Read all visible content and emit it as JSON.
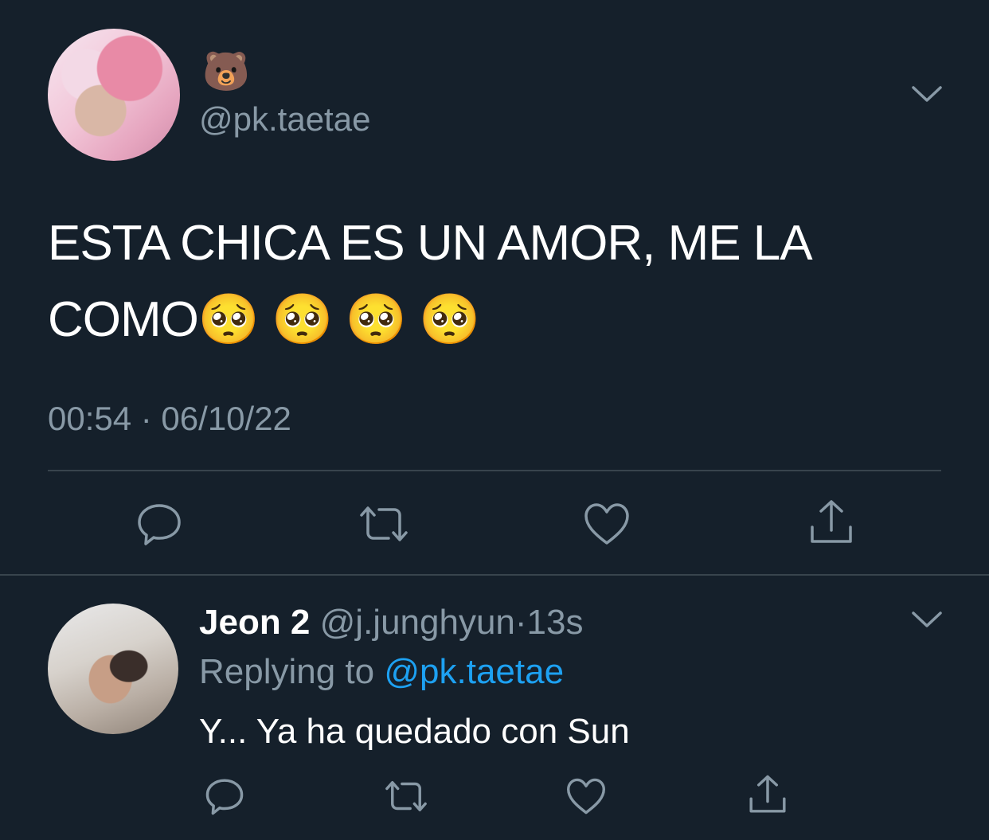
{
  "main_tweet": {
    "display_name": "🐻",
    "handle": "@pk.taetae",
    "text": "ESTA CHICA ES UN AMOR, ME LA COMO🥺 🥺 🥺 🥺",
    "timestamp": "00:54 · 06/10/22",
    "avatar_icon": "profile-photo",
    "menu_icon": "chevron-down-icon",
    "actions": [
      "reply-icon",
      "retweet-icon",
      "like-icon",
      "share-icon"
    ]
  },
  "reply_tweet": {
    "display_name": "Jeon 2",
    "handle": "@j.junghyun",
    "separator": "·",
    "time": "13s",
    "replying_prefix": "Replying to ",
    "replying_to": "@pk.taetae",
    "text": "Y... Ya ha quedado con Sun",
    "avatar_icon": "profile-photo",
    "menu_icon": "chevron-down-icon",
    "actions": [
      "reply-icon",
      "retweet-icon",
      "like-icon",
      "share-icon"
    ]
  },
  "colors": {
    "background": "#15202b",
    "text_primary": "#ffffff",
    "text_secondary": "#8899a6",
    "link": "#1da1f2",
    "divider": "#38444d"
  }
}
